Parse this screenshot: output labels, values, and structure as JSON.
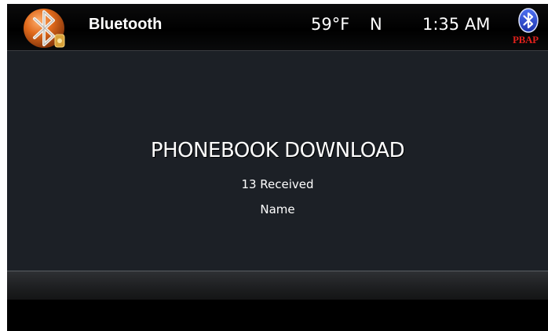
{
  "header": {
    "app_icon": "bluetooth-app-icon",
    "title": "Bluetooth",
    "temperature": "59°F",
    "heading": "N",
    "time": "1:35 AM",
    "bluetooth_status": {
      "icon": "bluetooth-icon",
      "profile_label": "PBAP"
    }
  },
  "dialog": {
    "title": "PHONEBOOK DOWNLOAD",
    "received_count": "13 Received",
    "current_item": "Name"
  },
  "colors": {
    "panel_background": "#1c2026",
    "app_icon_orange": "#d9651a",
    "bluetooth_blue": "#2f4fd8",
    "pbap_red": "#e0211c"
  }
}
